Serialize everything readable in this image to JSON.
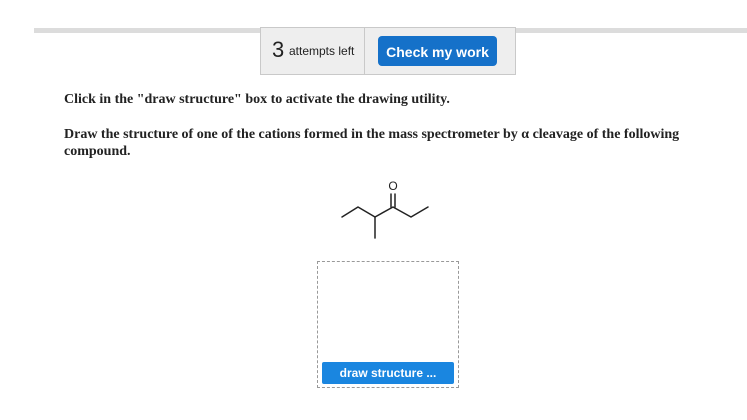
{
  "attempts": {
    "count": "3",
    "label": "attempts left"
  },
  "check_button": {
    "label": "Check my work"
  },
  "instruction": "Click in the \"draw structure\" box to activate the drawing utility.",
  "question": "Draw the structure of one of the cations formed in the mass spectrometer by α cleavage of the following compound.",
  "molecule": {
    "oxygen_label": "O"
  },
  "draw_area": {
    "button_label": "draw structure ..."
  },
  "colors": {
    "primary_button": "#1571c9",
    "draw_button": "#1a86e0",
    "panel_bg": "#eeeeee"
  }
}
